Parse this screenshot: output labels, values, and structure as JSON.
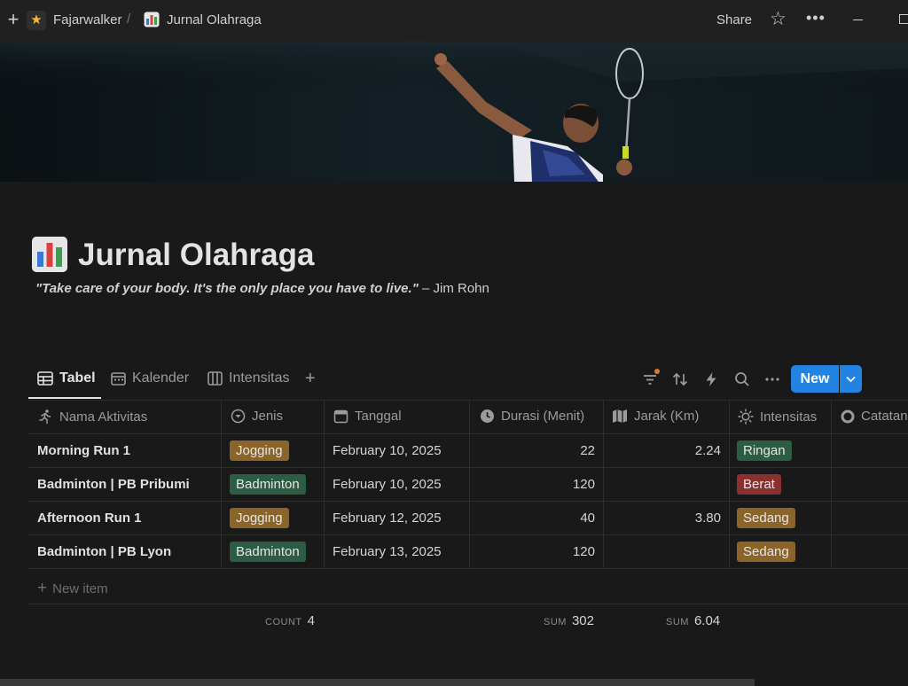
{
  "topbar": {
    "workspace": "Fajarwalker",
    "separator": "/",
    "page": "Jurnal Olahraga",
    "share_label": "Share",
    "more_label": "•••"
  },
  "page": {
    "title": "Jurnal Olahraga",
    "quote": "\"Take care of your body. It's the only place you have to live.\"",
    "quote_author": " – Jim Rohn"
  },
  "views": {
    "tabs": [
      "Tabel",
      "Kalender",
      "Intensitas"
    ],
    "new_label": "New"
  },
  "table": {
    "columns": [
      "Nama Aktivitas",
      "Jenis",
      "Tanggal",
      "Durasi (Menit)",
      "Jarak (Km)",
      "Intensitas",
      "Catatan"
    ],
    "rows": [
      {
        "name": "Morning Run 1",
        "jenis": "Jogging",
        "tanggal": "February 10, 2025",
        "durasi": "22",
        "jarak": "2.24",
        "intensitas": "Ringan"
      },
      {
        "name": "Badminton | PB Pribumi",
        "jenis": "Badminton",
        "tanggal": "February 10, 2025",
        "durasi": "120",
        "jarak": "",
        "intensitas": "Berat"
      },
      {
        "name": "Afternoon Run 1",
        "jenis": "Jogging",
        "tanggal": "February 12, 2025",
        "durasi": "40",
        "jarak": "3.80",
        "intensitas": "Sedang"
      },
      {
        "name": "Badminton | PB Lyon",
        "jenis": "Badminton",
        "tanggal": "February 13, 2025",
        "durasi": "120",
        "jarak": "",
        "intensitas": "Sedang"
      }
    ],
    "new_item_label": "New item",
    "footer": {
      "count_label": "COUNT",
      "count_value": "4",
      "sum_durasi_label": "SUM",
      "sum_durasi_value": "302",
      "sum_jarak_label": "SUM",
      "sum_jarak_value": "6.04"
    }
  },
  "colors": {
    "jogging": "#8a6429",
    "badminton": "#2c5d44",
    "ringan": "#2c5d44",
    "berat": "#8b2f2f",
    "sedang": "#8a6429",
    "accent": "#2383e2"
  }
}
